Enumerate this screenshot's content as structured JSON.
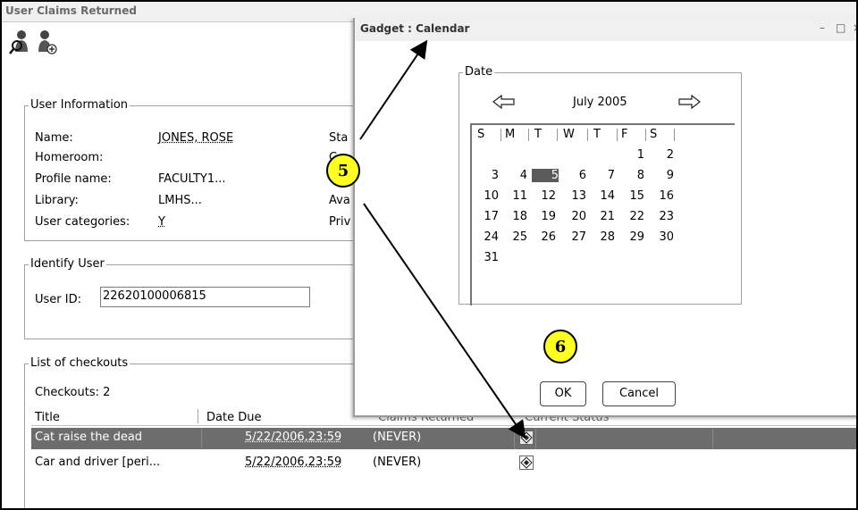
{
  "main": {
    "window_title": "User Claims Returned",
    "user_info": {
      "legend": "User Information",
      "name_label": "Name:",
      "name_value": "JONES, ROSE",
      "homeroom_label": "Homeroom:",
      "profile_label": "Profile name:",
      "profile_value": "FACULTY1...",
      "library_label": "Library:",
      "library_value": "LMHS...",
      "categories_label": "User categories:",
      "categories_value": "Y",
      "right_col": [
        "Sta",
        "C",
        "",
        "Ava",
        "Priv"
      ]
    },
    "identify": {
      "legend": "Identify User",
      "userid_label": "User ID:",
      "userid_value": "22620100006815"
    },
    "checkouts": {
      "legend": "List of checkouts",
      "count_label": "Checkouts: 2",
      "columns": [
        "Title",
        "Date Due",
        "Claims Returned",
        "Current Status"
      ],
      "rows": [
        {
          "title": "Cat raise the dead",
          "due": "5/22/2006,23:59",
          "claims": "(NEVER)"
        },
        {
          "title": "Car and driver [peri...",
          "due": "5/22/2006,23:59",
          "claims": "(NEVER)"
        }
      ]
    }
  },
  "dialog": {
    "title": "Gadget : Calendar",
    "controls": [
      "–",
      "□",
      "×"
    ],
    "legend": "Date",
    "month_label": "July 2005",
    "prev_icon": "left-arrow-icon",
    "next_icon": "right-arrow-icon",
    "day_headers": [
      "S",
      "M",
      "T",
      "W",
      "T",
      "F",
      "S"
    ],
    "weeks": [
      [
        "",
        "",
        "",
        "",
        "",
        "1",
        "2"
      ],
      [
        "3",
        "4",
        "5",
        "6",
        "7",
        "8",
        "9"
      ],
      [
        "10",
        "11",
        "12",
        "13",
        "14",
        "15",
        "16"
      ],
      [
        "17",
        "18",
        "19",
        "20",
        "21",
        "22",
        "23"
      ],
      [
        "24",
        "25",
        "26",
        "27",
        "28",
        "29",
        "30"
      ],
      [
        "31",
        "",
        "",
        "",
        "",
        "",
        ""
      ]
    ],
    "selected_day": "5",
    "ok_label": "OK",
    "cancel_label": "Cancel"
  },
  "callouts": {
    "c5": "5",
    "c6": "6"
  },
  "colors": {
    "callout": "#ffff22",
    "selected_row": "#6d6d6d",
    "today": "#5a5a5a"
  }
}
